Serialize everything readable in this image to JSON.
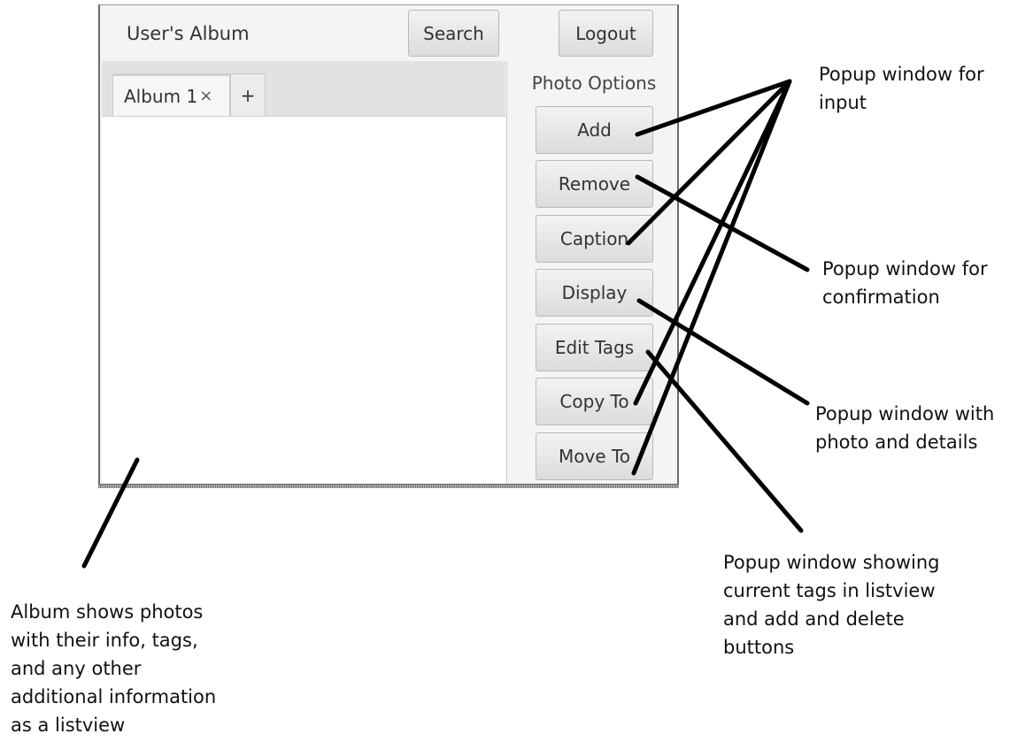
{
  "window": {
    "title": "User's Album",
    "search_label": "Search",
    "logout_label": "Logout"
  },
  "tabs": [
    {
      "label": "Album 1",
      "close": "×"
    },
    {
      "label": "+"
    }
  ],
  "photo_options": {
    "heading": "Photo Options",
    "buttons": [
      "Add",
      "Remove",
      "Caption",
      "Display",
      "Edit Tags",
      "Copy To",
      "Move To"
    ]
  },
  "annotations": [
    {
      "lines": [
        "Popup window for",
        "input"
      ]
    },
    {
      "lines": [
        "Popup window for",
        "confirmation"
      ]
    },
    {
      "lines": [
        "Popup window with",
        "photo and details"
      ]
    },
    {
      "lines": [
        "Popup window showing",
        "current tags in listview",
        "and add and delete",
        "buttons"
      ]
    },
    {
      "lines": [
        "Album shows photos",
        "with their info, tags,",
        "and any other",
        "additional information",
        "as a listview"
      ]
    }
  ]
}
